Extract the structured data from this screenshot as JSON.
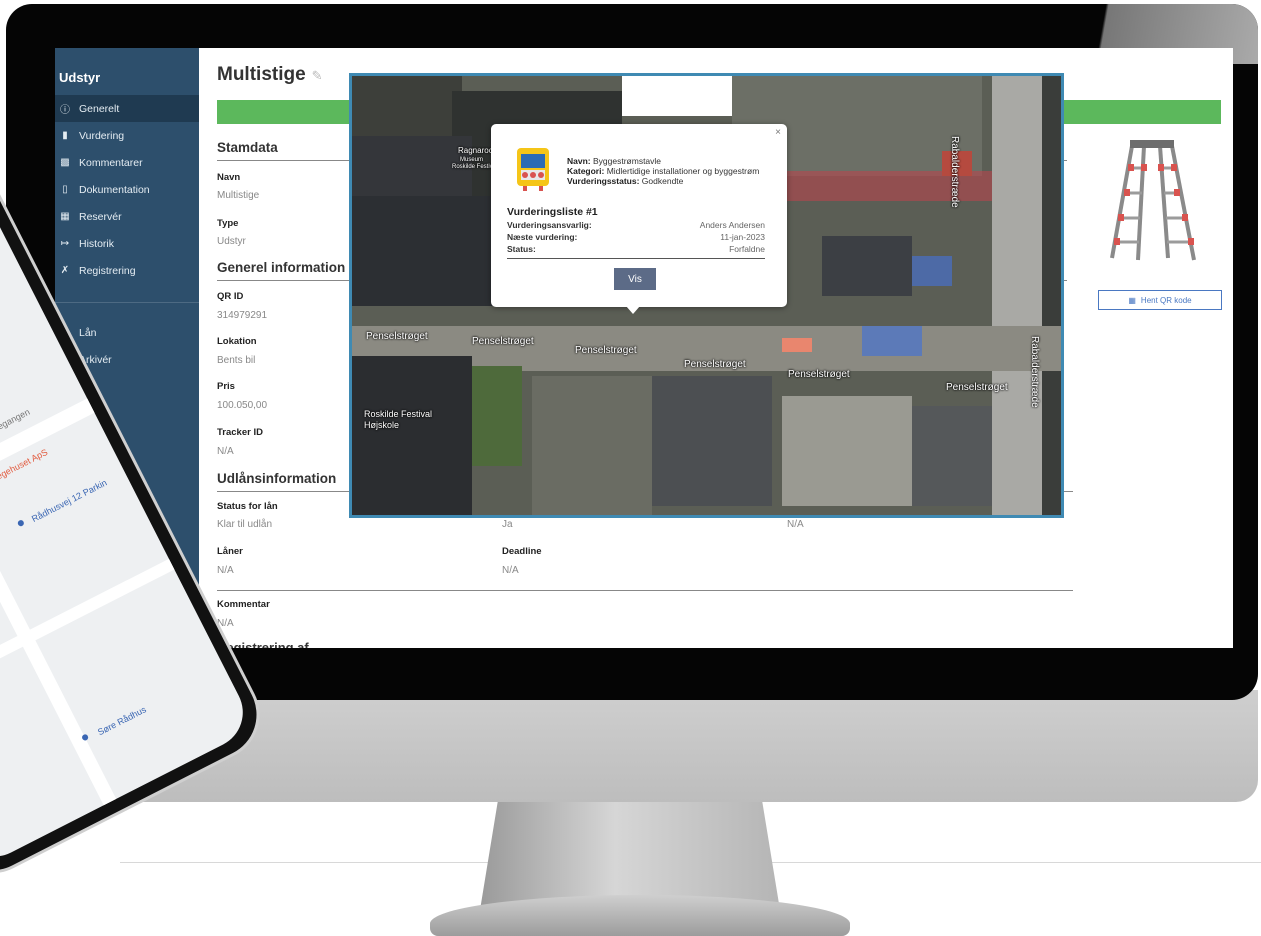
{
  "sidebar": {
    "title": "Udstyr",
    "items": [
      {
        "label": "Generelt",
        "icon": "info-icon"
      },
      {
        "label": "Vurdering",
        "icon": "clipboard-icon"
      },
      {
        "label": "Kommentarer",
        "icon": "comment-icon"
      },
      {
        "label": "Dokumentation",
        "icon": "document-icon"
      },
      {
        "label": "Reservér",
        "icon": "calendar-icon"
      },
      {
        "label": "Historik",
        "icon": "history-icon"
      },
      {
        "label": "Registrering",
        "icon": "tools-icon"
      }
    ],
    "items2": [
      {
        "label": "Lån",
        "icon": "handshake-icon"
      },
      {
        "label": "Arkivér",
        "icon": "archive-icon"
      }
    ]
  },
  "page": {
    "title": "Multistige",
    "status_color": "#5cb85c",
    "stamdata": {
      "heading": "Stamdata",
      "navn_label": "Navn",
      "navn_value": "Multistige",
      "type_label": "Type",
      "type_value": "Udstyr"
    },
    "general": {
      "heading": "Generel information",
      "qr_label": "QR ID",
      "qr_value": "314979291",
      "lokation_label": "Lokation",
      "lokation_value": "Bents bil",
      "pris_label": "Pris",
      "pris_value": "100.050,00",
      "tracker_label": "Tracker ID",
      "tracker_value": "N/A"
    },
    "udlaan": {
      "heading": "Udlånsinformation",
      "status_label": "Status for lån",
      "status_value": "Klar til udlån",
      "col2_value": "Ja",
      "col3_value": "N/A",
      "laaner_label": "Låner",
      "laaner_value": "N/A",
      "deadline_label": "Deadline",
      "deadline_value": "N/A",
      "kommentar_label": "Kommentar",
      "kommentar_value": "N/A"
    },
    "registration_heading_partial": "Registrering af ...",
    "qr_button": "Hent QR kode"
  },
  "map": {
    "street_labels": [
      "Penselstrøget",
      "Penselstrøget",
      "Penselstrøget",
      "Penselstrøget",
      "Penselstrøget",
      "Penselstrøget",
      "Rabalderstræde",
      "Rabalderstræde"
    ],
    "poi_labels": [
      "Ragnarock",
      "Museum",
      "Roskilde Festival",
      "Roskilde Festival",
      "Højskole"
    ],
    "popup": {
      "navn_label": "Navn:",
      "navn_value": "Byggestrømstavle",
      "kategori_label": "Kategori:",
      "kategori_value": "Midlertidige installationer og byggestrøm",
      "status_label": "Vurderingsstatus:",
      "status_value": "Godkendte",
      "list_title": "Vurderingsliste #1",
      "rows": [
        {
          "k": "Vurderingsansvarlig:",
          "v": "Anders Andersen"
        },
        {
          "k": "Næste vurdering:",
          "v": "11-jan-2023"
        },
        {
          "k": "Status:",
          "v": "Forfaldne"
        }
      ],
      "button": "Vis",
      "close": "×"
    }
  },
  "phone": {
    "labels": [
      "Lægehuset ApS",
      "Rådhusvej 12 Parkin",
      "Søre Rådhus",
      "Fiegangen"
    ]
  }
}
